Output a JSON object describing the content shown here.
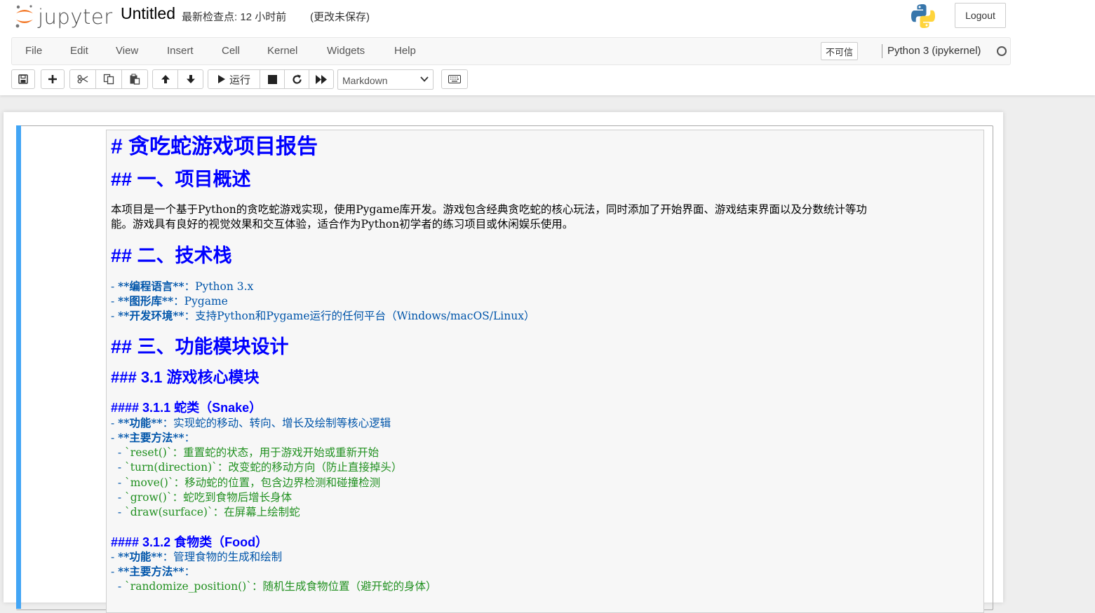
{
  "header": {
    "logo_text": "jupyter",
    "notebook_title": "Untitled",
    "checkpoint": "最新检查点: 12 小时前",
    "unsaved": "(更改未保存)",
    "logout_label": "Logout"
  },
  "menubar": {
    "items": [
      "File",
      "Edit",
      "View",
      "Insert",
      "Cell",
      "Kernel",
      "Widgets",
      "Help"
    ],
    "trust_label": "不可信",
    "kernel_name": "Python 3 (ipykernel)"
  },
  "toolbar": {
    "save_icon": "save-icon",
    "add_icon": "plus-icon",
    "cut_icon": "scissors-icon",
    "copy_icon": "copy-icon",
    "paste_icon": "paste-icon",
    "move_up_icon": "arrow-up-icon",
    "move_down_icon": "arrow-down-icon",
    "run_label": "运行",
    "stop_icon": "stop-icon",
    "restart_icon": "restart-icon",
    "fast_forward_icon": "fast-forward-icon",
    "cell_type": "Markdown",
    "keyboard_icon": "keyboard-icon"
  },
  "cell": {
    "lines": {
      "h1": "# 贪吃蛇游戏项目报告",
      "h2_overview": "## 一、项目概述",
      "para1": "本项目是一个基于Python的贪吃蛇游戏实现，使用Pygame库开发。游戏包含经典贪吃蛇的核心玩法，同时添加了开始界面、游戏结束界面以及分数统计等功",
      "para2": "能。游戏具有良好的视觉效果和交互体验，适合作为Python初学者的练习项目或休闲娱乐使用。",
      "h2_tech": "## 二、技术栈",
      "tech1_key": "**编程语言**",
      "tech1_val": "：Python 3.x",
      "tech2_key": "**图形库**",
      "tech2_val": "：Pygame",
      "tech3_key": "**开发环境**",
      "tech3_val": "：支持Python和Pygame运行的任何平台（Windows/macOS/Linux）",
      "h2_design": "## 三、功能模块设计",
      "h3_core": "### 3.1 游戏核心模块",
      "h4_snake": "#### 3.1.1 蛇类（Snake）",
      "snake_func_key": "**功能**",
      "snake_func_val": "：实现蛇的移动、转向、增长及绘制等核心逻辑",
      "snake_methods_key": "**主要方法**",
      "snake_methods_val": "：",
      "snake_m1": "`reset()`：重置蛇的状态，用于游戏开始或重新开始",
      "snake_m2": "`turn(direction)`：改变蛇的移动方向（防止直接掉头）",
      "snake_m3": "`move()`：移动蛇的位置，包含边界检测和碰撞检测",
      "snake_m4": "`grow()`：蛇吃到食物后增长身体",
      "snake_m5": "`draw(surface)`：在屏幕上绘制蛇",
      "h4_food": "#### 3.1.2 食物类（Food）",
      "food_func_key": "**功能**",
      "food_func_val": "：管理食物的生成和绘制",
      "food_methods_key": "**主要方法**",
      "food_methods_val": "：",
      "food_m1": "`randomize_position()`：随机生成食物位置（避开蛇的身体）"
    }
  }
}
